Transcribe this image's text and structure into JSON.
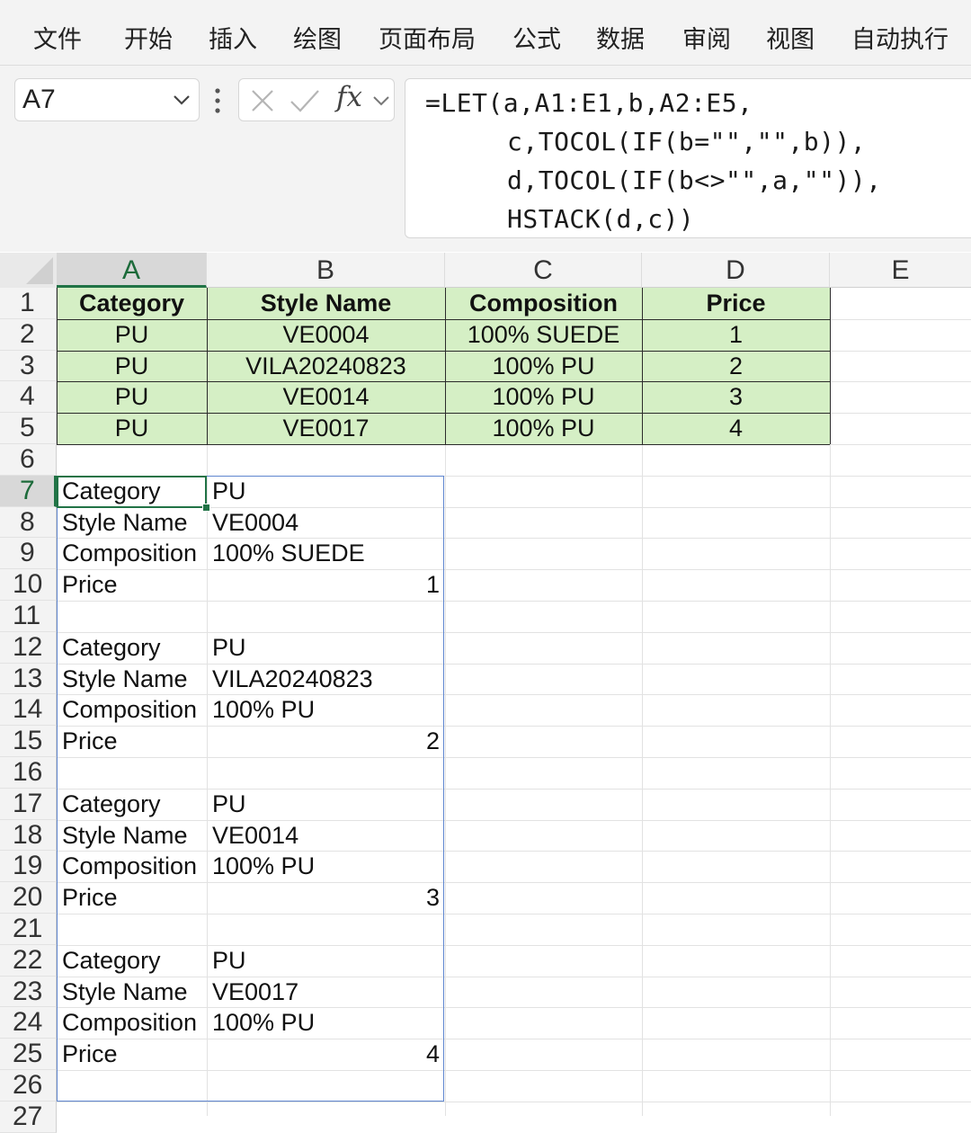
{
  "ribbon": {
    "tabs": [
      "文件",
      "开始",
      "插入",
      "绘图",
      "页面布局",
      "公式",
      "数据",
      "审阅",
      "视图",
      "自动执行"
    ]
  },
  "formula_bar": {
    "name_box": "A7",
    "fx_label": "fx",
    "formula_lines": [
      "=LET(a,A1:E1,b,A2:E5,",
      "c,TOCOL(IF(b=\"\",\"\",b)),",
      "d,TOCOL(IF(b<>\"\",a,\"\")),",
      "HSTACK(d,c))"
    ]
  },
  "columns": [
    "A",
    "B",
    "C",
    "D",
    "E"
  ],
  "selected_column": "A",
  "rows": [
    "1",
    "2",
    "3",
    "4",
    "5",
    "6",
    "7",
    "8",
    "9",
    "10",
    "11",
    "12",
    "13",
    "14",
    "15",
    "16",
    "17",
    "18",
    "19",
    "20",
    "21",
    "22",
    "23",
    "24",
    "25",
    "26",
    "27"
  ],
  "selected_row": "7",
  "table": {
    "header": [
      "Category",
      "Style Name",
      "Composition",
      "Price"
    ],
    "rows": [
      [
        "PU",
        "VE0004",
        "100% SUEDE",
        "1"
      ],
      [
        "PU",
        "VILA20240823",
        "100% PU",
        "2"
      ],
      [
        "PU",
        "VE0014",
        "100% PU",
        "3"
      ],
      [
        "PU",
        "VE0017",
        "100% PU",
        "4"
      ]
    ]
  },
  "spill": [
    {
      "label": "Category",
      "value": "PU"
    },
    {
      "label": "Style Name",
      "value": "VE0004"
    },
    {
      "label": "Composition",
      "value": "100% SUEDE"
    },
    {
      "label": "Price",
      "value": "1"
    },
    {
      "label": "",
      "value": ""
    },
    {
      "label": "Category",
      "value": "PU"
    },
    {
      "label": "Style Name",
      "value": "VILA20240823"
    },
    {
      "label": "Composition",
      "value": "100% PU"
    },
    {
      "label": "Price",
      "value": "2"
    },
    {
      "label": "",
      "value": ""
    },
    {
      "label": "Category",
      "value": "PU"
    },
    {
      "label": "Style Name",
      "value": "VE0014"
    },
    {
      "label": "Composition",
      "value": "100% PU"
    },
    {
      "label": "Price",
      "value": "3"
    },
    {
      "label": "",
      "value": ""
    },
    {
      "label": "Category",
      "value": "PU"
    },
    {
      "label": "Style Name",
      "value": "VE0017"
    },
    {
      "label": "Composition",
      "value": "100% PU"
    },
    {
      "label": "Price",
      "value": "4"
    },
    {
      "label": "",
      "value": ""
    }
  ],
  "colors": {
    "table_fill": "#d5efc5",
    "selection_green": "#217346",
    "spill_border": "#5f86cf"
  }
}
